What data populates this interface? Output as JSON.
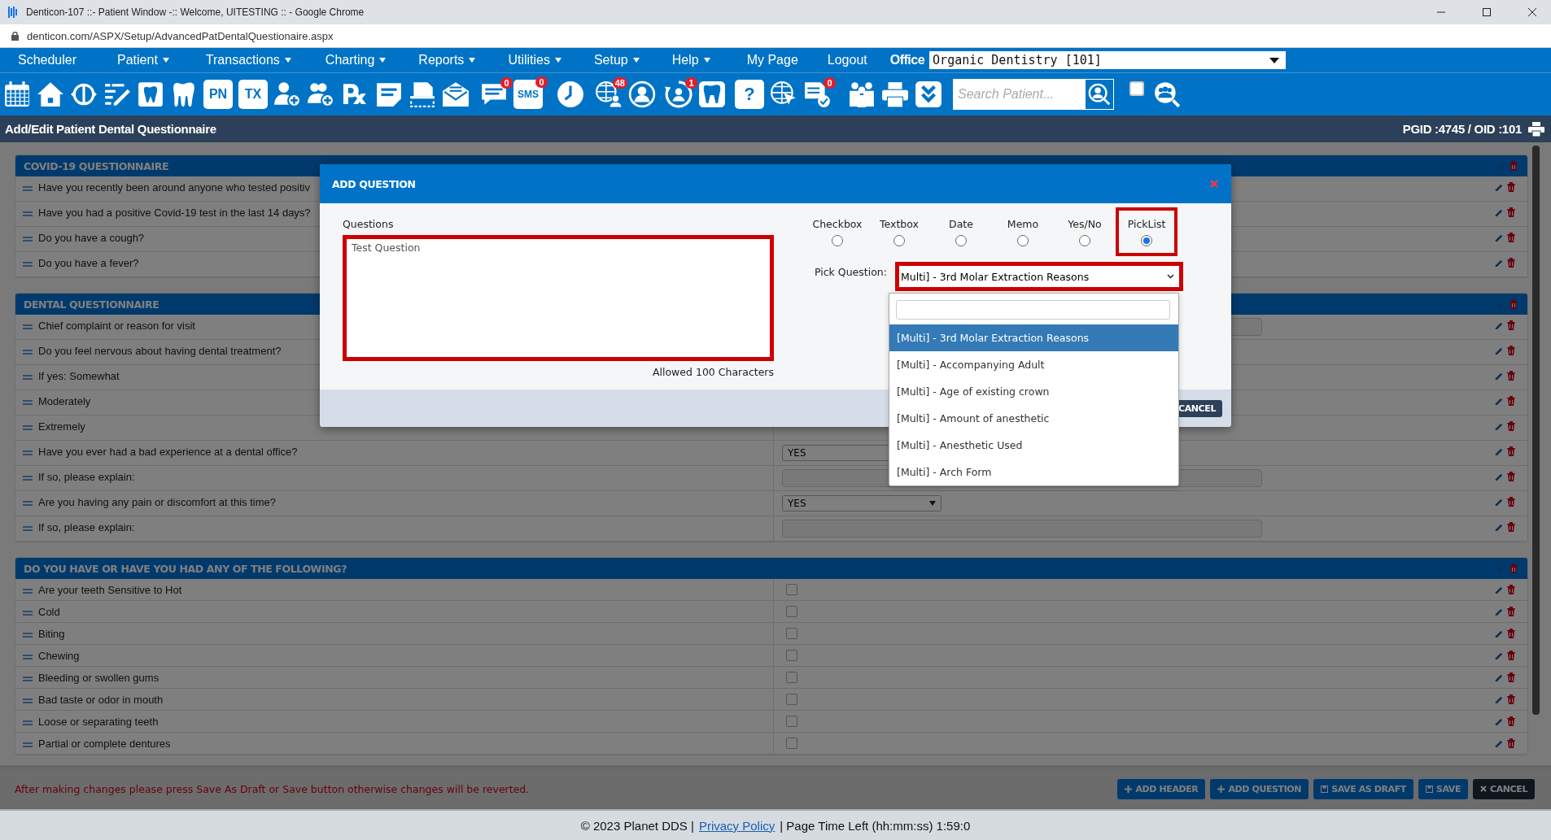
{
  "browser": {
    "title": "Denticon-107 ::- Patient Window -:: Welcome, UITESTING :: - Google Chrome",
    "url": "denticon.com/ASPX/Setup/AdvancedPatDentalQuestionaire.aspx"
  },
  "menu": [
    {
      "label": "Scheduler",
      "has_menu": false
    },
    {
      "label": "Patient",
      "has_menu": true
    },
    {
      "label": "Transactions",
      "has_menu": true
    },
    {
      "label": "Charting",
      "has_menu": true
    },
    {
      "label": "Reports",
      "has_menu": true
    },
    {
      "label": "Utilities",
      "has_menu": true
    },
    {
      "label": "Setup",
      "has_menu": true
    },
    {
      "label": "Help",
      "has_menu": true
    },
    {
      "label": "My Page",
      "has_menu": false
    },
    {
      "label": "Logout",
      "has_menu": false
    }
  ],
  "office": {
    "label": "Office",
    "value": "Organic Dentistry [101]"
  },
  "toolbar": {
    "labels": [
      "PN",
      "TX",
      "℞",
      "SMS",
      "?"
    ],
    "badges": [
      "0",
      "0",
      "48",
      "1",
      "0"
    ],
    "search": {
      "placeholder": "Search Patient..."
    },
    "checkbox": {
      "checked": false
    }
  },
  "page": {
    "title": "Add/Edit Patient Dental Questionnaire",
    "ids": "PGID :4745 / OID :101"
  },
  "sections": [
    {
      "title": "COVID-19 QUESTIONNAIRE",
      "questions": [
        {
          "text": "Have you recently been around anyone who tested positiv"
        },
        {
          "text": "Have you had a positive Covid-19 test in the last 14 days?"
        },
        {
          "text": "Do you have a cough?"
        },
        {
          "text": "Do you have a fever?"
        }
      ]
    },
    {
      "title": "DENTAL QUESTIONNAIRE",
      "questions": [
        {
          "text": "Chief complaint or reason for visit",
          "answer": {
            "kind": "text"
          }
        },
        {
          "text": "Do you feel nervous about having dental treatment?"
        },
        {
          "text": "If yes: Somewhat"
        },
        {
          "text": "Moderately"
        },
        {
          "text": "Extremely"
        },
        {
          "text": "Have you ever had a bad experience at a dental office?",
          "answer": {
            "kind": "select",
            "value": "YES"
          }
        },
        {
          "text": "If so, please explain:",
          "answer": {
            "kind": "text"
          }
        },
        {
          "text": "Are you having any pain or discomfort at this time?",
          "answer": {
            "kind": "select",
            "value": "YES"
          }
        },
        {
          "text": "If so, please explain:",
          "answer": {
            "kind": "text"
          }
        }
      ]
    },
    {
      "title": "DO YOU HAVE OR HAVE YOU HAD ANY OF THE FOLLOWING?",
      "questions": [
        {
          "text": "Are your teeth Sensitive to Hot",
          "answer": {
            "kind": "checkbox",
            "checked": false
          }
        },
        {
          "text": "Cold",
          "answer": {
            "kind": "checkbox",
            "checked": false
          }
        },
        {
          "text": "Biting",
          "answer": {
            "kind": "checkbox",
            "checked": false
          }
        },
        {
          "text": "Chewing",
          "answer": {
            "kind": "checkbox",
            "checked": false
          }
        },
        {
          "text": "Bleeding or swollen gums",
          "answer": {
            "kind": "checkbox",
            "checked": false
          }
        },
        {
          "text": "Bad taste or odor in mouth",
          "answer": {
            "kind": "checkbox",
            "checked": false
          }
        },
        {
          "text": "Loose or separating teeth",
          "answer": {
            "kind": "checkbox",
            "checked": false
          }
        },
        {
          "text": "Partial or complete dentures",
          "answer": {
            "kind": "checkbox",
            "checked": false
          }
        }
      ]
    }
  ],
  "notice": "After making changes please press Save As Draft or Save button otherwise changes will be reverted.",
  "actions": [
    {
      "label": "ADD HEADER",
      "kind": "add",
      "dark": false
    },
    {
      "label": "ADD QUESTION",
      "kind": "add",
      "dark": false
    },
    {
      "label": "SAVE AS DRAFT",
      "kind": "save",
      "dark": false
    },
    {
      "label": "SAVE",
      "kind": "save",
      "dark": false
    },
    {
      "label": "CANCEL",
      "kind": "close",
      "dark": true
    }
  ],
  "modal": {
    "title": "ADD QUESTION",
    "question_label": "Questions",
    "question_value": "Test Question",
    "question_highlighted": true,
    "limit_note": "Allowed 100 Characters",
    "types": [
      {
        "label": "Checkbox",
        "selected": false,
        "highlighted": false
      },
      {
        "label": "Textbox",
        "selected": false,
        "highlighted": false
      },
      {
        "label": "Date",
        "selected": false,
        "highlighted": false
      },
      {
        "label": "Memo",
        "selected": false,
        "highlighted": false
      },
      {
        "label": "Yes/No",
        "selected": false,
        "highlighted": false
      },
      {
        "label": "PickList",
        "selected": true,
        "highlighted": true
      }
    ],
    "pick_label": "Pick Question:",
    "pick_value": "Multi] - 3rd Molar Extraction Reasons",
    "pick_highlighted": true,
    "options": [
      {
        "label": "[Multi] - 3rd Molar Extraction Reasons",
        "selected": true
      },
      {
        "label": "[Multi] - Accompanying Adult",
        "selected": false
      },
      {
        "label": "[Multi] - Age of existing crown",
        "selected": false
      },
      {
        "label": "[Multi] - Amount of anesthetic",
        "selected": false
      },
      {
        "label": "[Multi] - Anesthetic Used",
        "selected": false
      },
      {
        "label": "[Multi] - Arch Form",
        "selected": false
      }
    ],
    "cancel": "CANCEL"
  },
  "footer": {
    "copyright": "© 2023 Planet DDS |",
    "link": "Privacy Policy",
    "timer": "| Page Time Left (hh:mm:ss) 1:59:0"
  }
}
